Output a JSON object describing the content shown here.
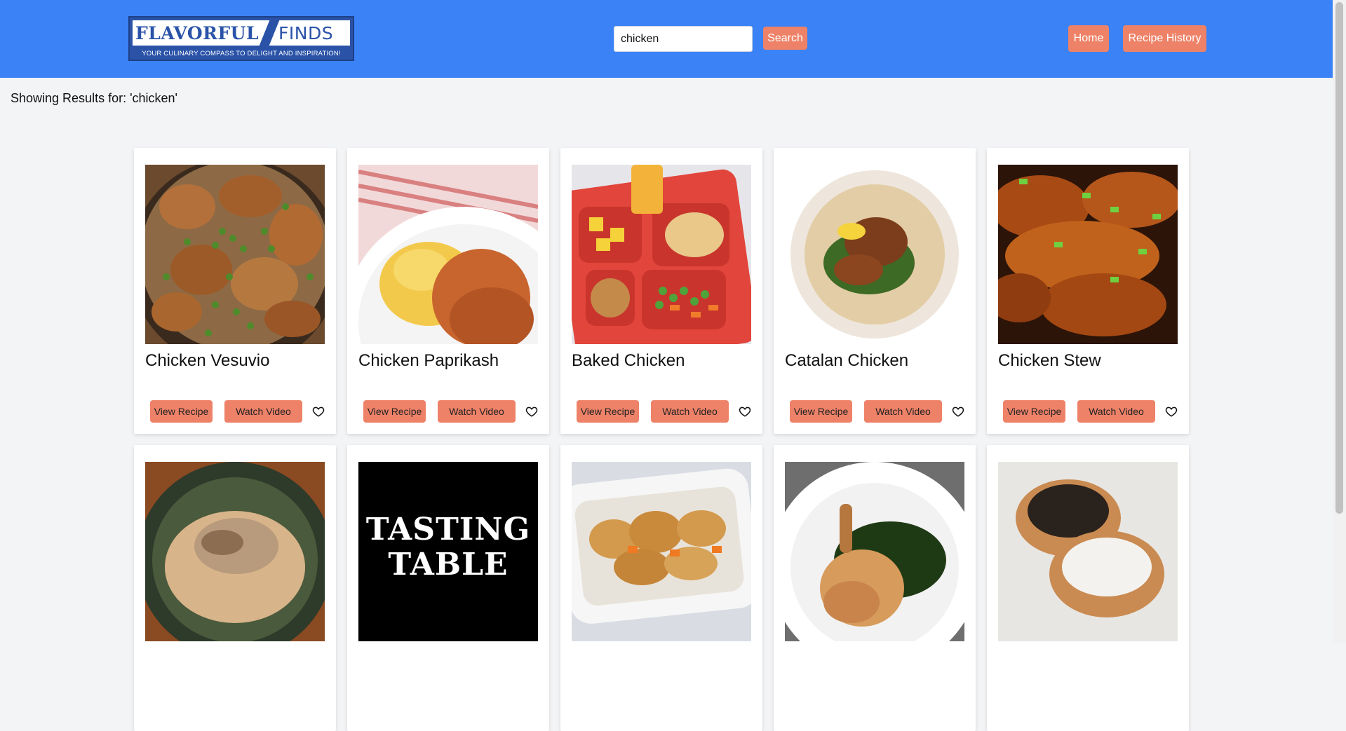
{
  "app": {
    "logo_word1": "FLAVORFUL",
    "logo_word2": "FINDS",
    "logo_tagline": "YOUR CULINARY COMPASS TO DELIGHT AND INSPIRATION!"
  },
  "search": {
    "value": "chicken",
    "button_label": "Search"
  },
  "nav": {
    "home_label": "Home",
    "history_label": "Recipe History"
  },
  "results": {
    "heading": "Showing Results for: 'chicken'"
  },
  "card_actions": {
    "view_label": "View Recipe",
    "watch_label": "Watch Video"
  },
  "recipes": [
    {
      "title": "Chicken Vesuvio"
    },
    {
      "title": "Chicken Paprikash"
    },
    {
      "title": "Baked Chicken"
    },
    {
      "title": "Catalan Chicken"
    },
    {
      "title": "Chicken Stew"
    },
    {
      "title": ""
    },
    {
      "title": "",
      "image_text_1": "TASTING",
      "image_text_2": "TABLE"
    },
    {
      "title": ""
    },
    {
      "title": ""
    },
    {
      "title": ""
    }
  ],
  "colors": {
    "header": "#3b82f6",
    "button": "#ee8268",
    "background": "#f3f4f6",
    "card": "#ffffff"
  },
  "icons": {
    "favorite": "heart-outline-icon"
  }
}
